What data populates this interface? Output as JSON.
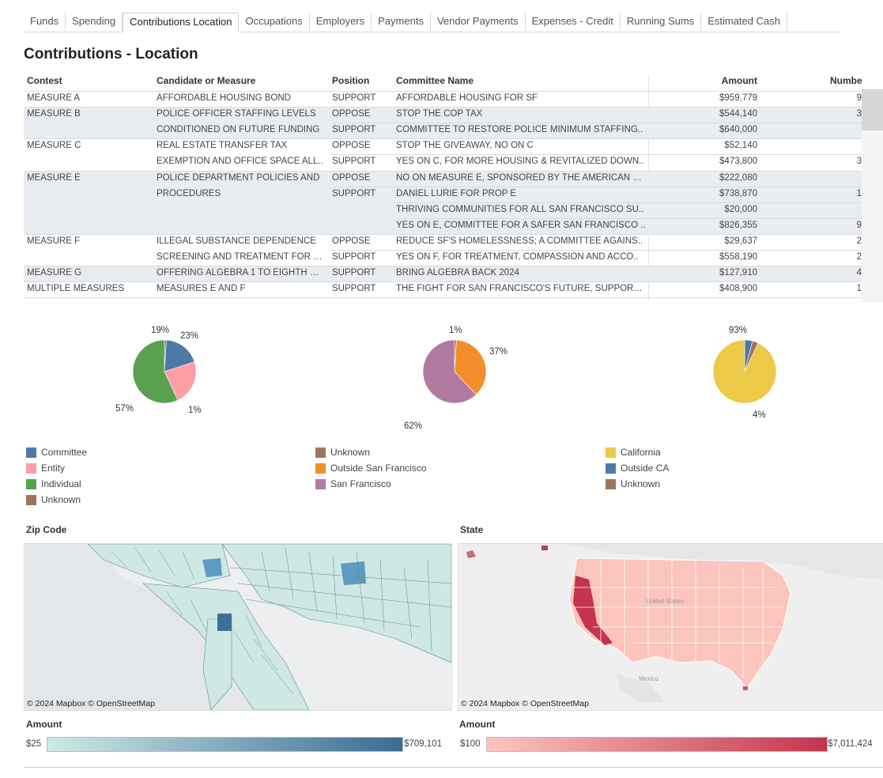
{
  "tabs": [
    "Funds",
    "Spending",
    "Contributions Location",
    "Occupations",
    "Employers",
    "Payments",
    "Vendor Payments",
    "Expenses - Credit",
    "Running Sums",
    "Estimated Cash"
  ],
  "active_tab": 2,
  "title": "Contributions - Location",
  "table": {
    "headers": {
      "contest": "Contest",
      "candidate": "Candidate or Measure",
      "position": "Position",
      "committee": "Committee Name",
      "amount": "Amount",
      "number": "Numbe"
    },
    "rows": [
      {
        "contest": "MEASURE A",
        "candidate": "AFFORDABLE HOUSING BOND",
        "position": "SUPPORT",
        "committee": "AFFORDABLE HOUSING FOR SF",
        "amount": "$959,779",
        "number": "9"
      },
      {
        "contest": "MEASURE B",
        "candidate": "POLICE OFFICER STAFFING LEVELS",
        "position": "OPPOSE",
        "committee": "STOP THE COP TAX",
        "amount": "$544,140",
        "number": "3"
      },
      {
        "contest": "",
        "candidate": "CONDITIONED ON FUTURE FUNDING",
        "position": "SUPPORT",
        "committee": "COMMITTEE TO RESTORE POLICE MINIMUM STAFFING..",
        "amount": "$640,000",
        "number": ""
      },
      {
        "contest": "MEASURE C",
        "candidate": "REAL ESTATE TRANSFER TAX",
        "position": "OPPOSE",
        "committee": "STOP THE GIVEAWAY, NO ON C",
        "amount": "$52,140",
        "number": ""
      },
      {
        "contest": "",
        "candidate": "EXEMPTION AND OFFICE SPACE ALL..",
        "position": "SUPPORT",
        "committee": "YES ON C, FOR MORE HOUSING & REVITALIZED DOWN..",
        "amount": "$473,800",
        "number": "3"
      },
      {
        "contest": "MEASURE E",
        "candidate": "POLICE DEPARTMENT POLICIES AND",
        "position": "OPPOSE",
        "committee": "NO ON MEASURE E, SPONSORED BY THE AMERICAN CI..",
        "amount": "$222,080",
        "number": ""
      },
      {
        "contest": "",
        "candidate": "PROCEDURES",
        "position": "SUPPORT",
        "committee": "DANIEL LURIE FOR PROP E",
        "amount": "$738,870",
        "number": "1"
      },
      {
        "contest": "",
        "candidate": "",
        "position": "",
        "committee": "THRIVING COMMUNITIES FOR ALL SAN FRANCISCO SU..",
        "amount": "$20,000",
        "number": ""
      },
      {
        "contest": "",
        "candidate": "",
        "position": "",
        "committee": "YES ON E, COMMITTEE FOR A SAFER SAN FRANCISCO ..",
        "amount": "$826,355",
        "number": "9"
      },
      {
        "contest": "MEASURE F",
        "candidate": "ILLEGAL SUBSTANCE DEPENDENCE",
        "position": "OPPOSE",
        "committee": "REDUCE SF'S HOMELESSNESS; A COMMITTEE AGAINS..",
        "amount": "$29,637",
        "number": "2"
      },
      {
        "contest": "",
        "candidate": "SCREENING AND TREATMENT FOR R..",
        "position": "SUPPORT",
        "committee": "YES ON F, FOR TREATMENT, COMPASSION AND ACCO..",
        "amount": "$558,190",
        "number": "2"
      },
      {
        "contest": "MEASURE G",
        "candidate": "OFFERING ALGEBRA 1 TO EIGHTH GR..",
        "position": "SUPPORT",
        "committee": "BRING ALGEBRA BACK 2024",
        "amount": "$127,910",
        "number": "4"
      },
      {
        "contest": "MULTIPLE MEASURES",
        "candidate": "MEASURES E AND F",
        "position": "SUPPORT",
        "committee": "THE FIGHT FOR SAN FRANCISCO'S FUTURE, SUPPORTI..",
        "amount": "$408,900",
        "number": "1"
      }
    ]
  },
  "chart_data": [
    {
      "type": "pie",
      "labels": [
        "Committee",
        "Entity",
        "Individual",
        "Unknown"
      ],
      "values": [
        19,
        23,
        57,
        1
      ],
      "value_labels": [
        "19%",
        "23%",
        "57%",
        "1%"
      ],
      "colors": [
        "#4e79a7",
        "#ff9da7",
        "#59a14f",
        "#9c755f"
      ]
    },
    {
      "type": "pie",
      "labels": [
        "Unknown",
        "Outside San Francisco",
        "San Francisco"
      ],
      "values": [
        1,
        37,
        62
      ],
      "value_labels": [
        "1%",
        "37%",
        "62%"
      ],
      "colors": [
        "#9c755f",
        "#f28e2b",
        "#b07aa1"
      ]
    },
    {
      "type": "pie",
      "labels": [
        "California",
        "Outside CA",
        "Unknown"
      ],
      "values": [
        93,
        4,
        3
      ],
      "value_labels": [
        "93%",
        "4%"
      ],
      "colors": [
        "#edc948",
        "#4e79a7",
        "#9c755f"
      ]
    }
  ],
  "legends": [
    [
      {
        "label": "Committee",
        "color": "#4e79a7"
      },
      {
        "label": "Entity",
        "color": "#ff9da7"
      },
      {
        "label": "Individual",
        "color": "#59a14f"
      },
      {
        "label": "Unknown",
        "color": "#9c755f"
      }
    ],
    [
      {
        "label": "Unknown",
        "color": "#9c755f"
      },
      {
        "label": "Outside San Francisco",
        "color": "#f28e2b"
      },
      {
        "label": "San Francisco",
        "color": "#b07aa1"
      }
    ],
    [
      {
        "label": "California",
        "color": "#edc948"
      },
      {
        "label": "Outside CA",
        "color": "#4e79a7"
      },
      {
        "label": "Unknown",
        "color": "#9c755f"
      }
    ]
  ],
  "maps": {
    "zip": {
      "title": "Zip Code",
      "credit": "© 2024 Mapbox  © OpenStreetMap",
      "amount_title": "Amount",
      "min": "$25",
      "max": "$709,101",
      "color_low": "#cdeae5",
      "color_high": "#3a6b93"
    },
    "state": {
      "title": "State",
      "credit": "© 2024 Mapbox  © OpenStreetMap",
      "amount_title": "Amount",
      "min": "$100",
      "max": "$7,011,424",
      "color_low": "#fcc6bd",
      "color_high": "#c2344f",
      "map_labels": {
        "us": "United States",
        "mexico": "Mexico"
      }
    }
  }
}
